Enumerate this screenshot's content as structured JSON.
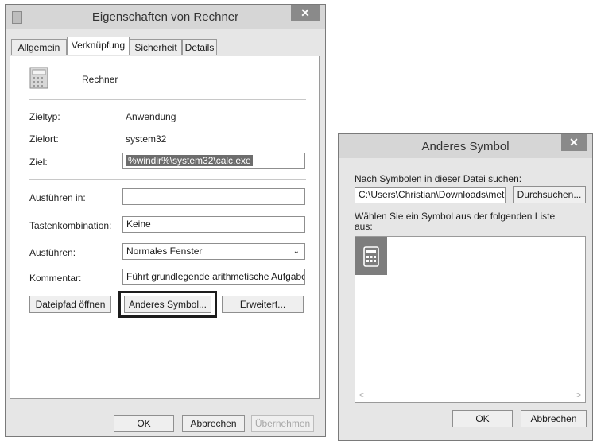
{
  "props_dialog": {
    "title": "Eigenschaften von Rechner",
    "close_glyph": "✕",
    "tabs": [
      "Allgemein",
      "Verknüpfung",
      "Sicherheit",
      "Details"
    ],
    "active_tab": "Verknüpfung",
    "app_name": "Rechner",
    "fields": {
      "zieltyp_label": "Zieltyp:",
      "zieltyp_value": "Anwendung",
      "zielort_label": "Zielort:",
      "zielort_value": "system32",
      "ziel_label": "Ziel:",
      "ziel_value": "%windir%\\system32\\calc.exe",
      "ausfuehren_in_label": "Ausführen in:",
      "ausfuehren_in_value": "",
      "tasten_label": "Tastenkombination:",
      "tasten_value": "Keine",
      "ausfuehren_label": "Ausführen:",
      "ausfuehren_value": "Normales Fenster",
      "kommentar_label": "Kommentar:",
      "kommentar_value": "Führt grundlegende arithmetische Aufgaben"
    },
    "buttons": {
      "dateipfad": "Dateipfad öffnen",
      "anderes_symbol": "Anderes Symbol...",
      "erweitert": "Erweitert...",
      "ok": "OK",
      "abbrechen": "Abbrechen",
      "uebernehmen": "Übernehmen"
    }
  },
  "symbol_dialog": {
    "title": "Anderes Symbol",
    "close_glyph": "✕",
    "search_label": "Nach Symbolen in dieser Datei suchen:",
    "path_value": "C:\\Users\\Christian\\Downloads\\metr",
    "browse_button": "Durchsuchen...",
    "list_label": "Wählen Sie ein Symbol aus der folgenden Liste aus:",
    "scroll_left": "<",
    "scroll_right": ">",
    "ok_button": "OK",
    "cancel_button": "Abbrechen"
  },
  "icons": [
    "calculator-icon",
    "close-icon",
    "chevron-down-icon"
  ],
  "colors": {
    "selection": "#6d6d6d",
    "dialog_bg": "#e6e6e6",
    "close_button": "#8a8a8a"
  }
}
